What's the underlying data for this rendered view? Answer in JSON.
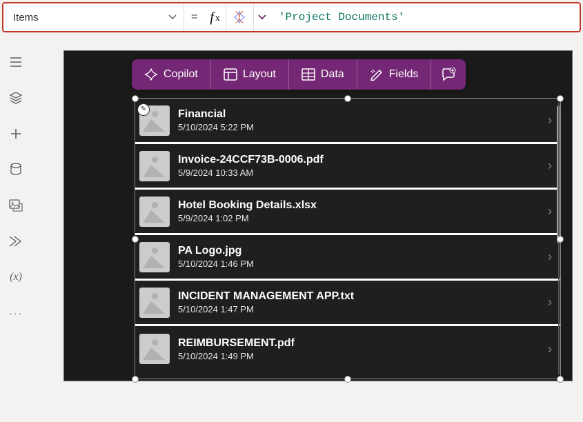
{
  "formula": {
    "property": "Items",
    "value": "'Project Documents'"
  },
  "toolbar": {
    "copilot": "Copilot",
    "layout": "Layout",
    "data": "Data",
    "fields": "Fields"
  },
  "gallery": {
    "items": [
      {
        "title": "Financial",
        "subtitle": "5/10/2024 5:22 PM"
      },
      {
        "title": "Invoice-24CCF73B-0006.pdf",
        "subtitle": "5/9/2024 10:33 AM"
      },
      {
        "title": "Hotel Booking Details.xlsx",
        "subtitle": "5/9/2024 1:02 PM"
      },
      {
        "title": "PA Logo.jpg",
        "subtitle": "5/10/2024 1:46 PM"
      },
      {
        "title": "INCIDENT MANAGEMENT APP.txt",
        "subtitle": "5/10/2024 1:47 PM"
      },
      {
        "title": "REIMBURSEMENT.pdf",
        "subtitle": "5/10/2024 1:49 PM"
      }
    ]
  }
}
